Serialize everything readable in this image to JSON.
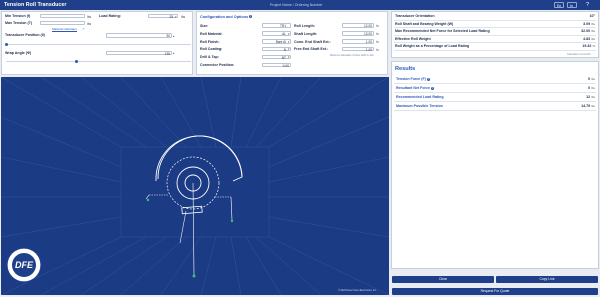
{
  "app": {
    "title": "Tension Roll Transducer",
    "project_placeholder": "Project Name / Ordering Number",
    "language": "En",
    "units": "In",
    "help_glyph": "?"
  },
  "inputs": {
    "min_tension_label": "Min Tension (f)",
    "min_tension_unit": "lbs",
    "max_tension_label": "Max Tension (T)",
    "max_tension_unit": "lbs",
    "load_rating_label": "Load Rating:",
    "load_rating_value": "25",
    "load_rating_unit": "lbs",
    "material_calc_link": "Material Calculator",
    "transducer_position_label": "Transducer Position (θ)",
    "transducer_position_value": "90",
    "wrap_angle_label": "Wrap Angle (Φ)",
    "wrap_angle_value": "135",
    "transducer_position_fraction": 0.0,
    "wrap_angle_fraction": 0.38
  },
  "config": {
    "title": "Configuration and Options",
    "size_label": "Size:",
    "size_value": "TR1",
    "roll_material_label": "Roll Material:",
    "roll_material_value": "AL",
    "roll_finish_label": "Roll Finish:",
    "roll_finish_value": "Bare Ai",
    "roll_coating_label": "Roll Coating:",
    "roll_coating_value": "N",
    "drill_tap_label": "Drill & Tap:",
    "drill_tap_value": "NT",
    "connector_position_label": "Connector Position:",
    "connector_position_value": "0.00",
    "roll_length_label": "Roll Length:",
    "roll_length_value": "12.00",
    "shaft_length_label": "Shaft Length:",
    "shaft_length_value": "13.00",
    "conn_end_label": "Conn. End Shaft Ext.:",
    "conn_end_value": "1.00",
    "free_end_label": "Free End Shaft Ext.:",
    "free_end_value": "1.00",
    "length_unit": "in",
    "note": "Maximum allowable roll face width is 12in"
  },
  "summary": {
    "rows": [
      {
        "label": "Transducer Orientation",
        "value": "10°",
        "unit": ""
      },
      {
        "label": "Roll Shaft and Bearing Weight (W)",
        "value": "3.09",
        "unit": "lbs"
      },
      {
        "label": "Max Recommended Net Force for Selected Load Rating",
        "value": "32.00",
        "unit": "lbs"
      },
      {
        "label": "Effective Roll Weight",
        "value": "4.83",
        "unit": "lbs"
      },
      {
        "label": "Roll Weight as a Percentage of Load Rating",
        "value": "19.32",
        "unit": "%"
      }
    ],
    "note": "Calculation successful"
  },
  "results": {
    "title": "Results",
    "rows": [
      {
        "label": "Tension Force (F)",
        "value": "0",
        "unit": "lbs",
        "info": true
      },
      {
        "label": "Resultant Net Force",
        "value": "0",
        "unit": "lbs",
        "info": true
      },
      {
        "label": "Recommended Load Rating",
        "value": "12",
        "unit": "lbs",
        "info": false
      },
      {
        "label": "Maximum Possible Tension",
        "value": "14.79",
        "unit": "lbs",
        "info": false
      }
    ]
  },
  "actions": {
    "clear": "Clear",
    "copy_link": "Copy Link",
    "request_quote": "Request For Quote"
  },
  "canvas": {
    "copyright": "© 2024 Dover Flexo Electronics, Inc.",
    "logo_text": "DFE",
    "logo_ring_text": "DOVER FLEXO ELECTRONICS",
    "colors": {
      "background": "#1c3b85",
      "grid": "#3b5aa3",
      "web": "#ffffff",
      "anchor": "#36c07a"
    }
  },
  "colors": {
    "primary": "#1f3f8a",
    "accent": "#2b57b8"
  }
}
